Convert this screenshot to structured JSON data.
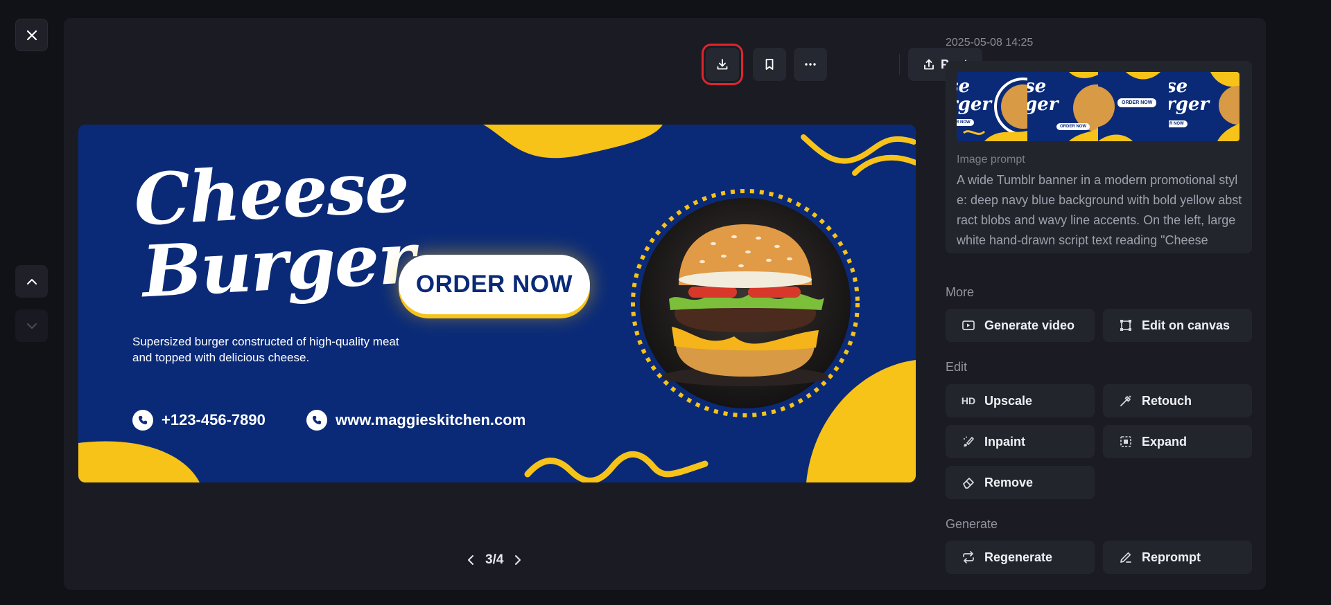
{
  "window": {
    "close_icon": "close-icon",
    "nav_up_icon": "chevron-up-icon",
    "nav_down_icon": "chevron-down-icon"
  },
  "toolbar": {
    "download_icon": "download-icon",
    "bookmark_icon": "bookmark-icon",
    "more_icon": "more-horizontal-icon",
    "post_label": "Post"
  },
  "banner": {
    "title_line1": "Cheese",
    "title_line2": "Burger",
    "tagline": "Supersized burger constructed of high-quality meat and topped with delicious cheese.",
    "order_button": "ORDER NOW",
    "phone": "+123-456-7890",
    "website": "www.maggieskitchen.com",
    "colors": {
      "navy": "#0a2a78",
      "yellow": "#f7c318"
    }
  },
  "pager": {
    "current": "3/4"
  },
  "details": {
    "timestamp": "2025-05-08 14:25",
    "prompt_label": "Image prompt",
    "prompt_text": "A wide Tumblr banner in a modern promotional style: deep navy blue background with bold yellow abstract blobs and wavy line accents. On the left, large white hand-drawn script text reading \"Cheese"
  },
  "sections": {
    "more": {
      "label": "More",
      "buttons": [
        "Generate video",
        "Edit on canvas"
      ]
    },
    "edit": {
      "label": "Edit",
      "buttons": [
        "Upscale",
        "Retouch",
        "Inpaint",
        "Expand",
        "Remove"
      ],
      "upscale_icon_text": "HD"
    },
    "generate": {
      "label": "Generate",
      "buttons": [
        "Regenerate",
        "Reprompt"
      ]
    }
  }
}
